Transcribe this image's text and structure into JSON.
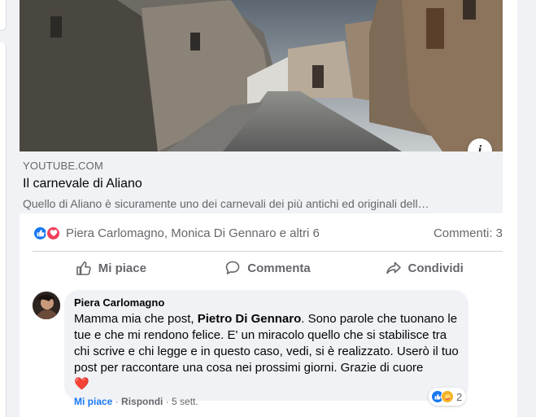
{
  "link_preview": {
    "domain": "YOUTUBE.COM",
    "title": "Il carnevale di Aliano",
    "description": "Quello di Aliano è sicuramente uno dei carnevali dei più antichi ed originali dell…",
    "info_glyph": "i"
  },
  "reactions": {
    "icons": [
      "like-icon",
      "love-icon"
    ],
    "names": "Piera Carlomagno, Monica Di Gennaro e altri 6",
    "comments_count": "Commenti: 3"
  },
  "actions": {
    "like_label": "Mi piace",
    "comment_label": "Commenta",
    "share_label": "Condividi"
  },
  "comment": {
    "author": "Piera Carlomagno",
    "text_before": "Mamma mia che post, ",
    "mention": "Pietro Di Gennaro",
    "text_after": ". Sono parole che tuonano le tue e che mi rendono felice. E' un miracolo quello che si stabilisce tra chi scrive e chi legge e in questo caso, vedi, si è realizzato. Userò il tuo post per raccontare una cosa nei prossimi giorni. Grazie di cuore",
    "emoji": "❤️",
    "reaction_count": "2",
    "like_label": "Mi piace",
    "separator1": " · ",
    "reply_label": "Rispondi",
    "separator2": " · ",
    "time": "5 sett."
  },
  "colors": {
    "brand_blue": "#1877f2",
    "love_red": "#f33e58",
    "muted_text": "#65676b",
    "bubble_bg": "#f0f2f5"
  }
}
